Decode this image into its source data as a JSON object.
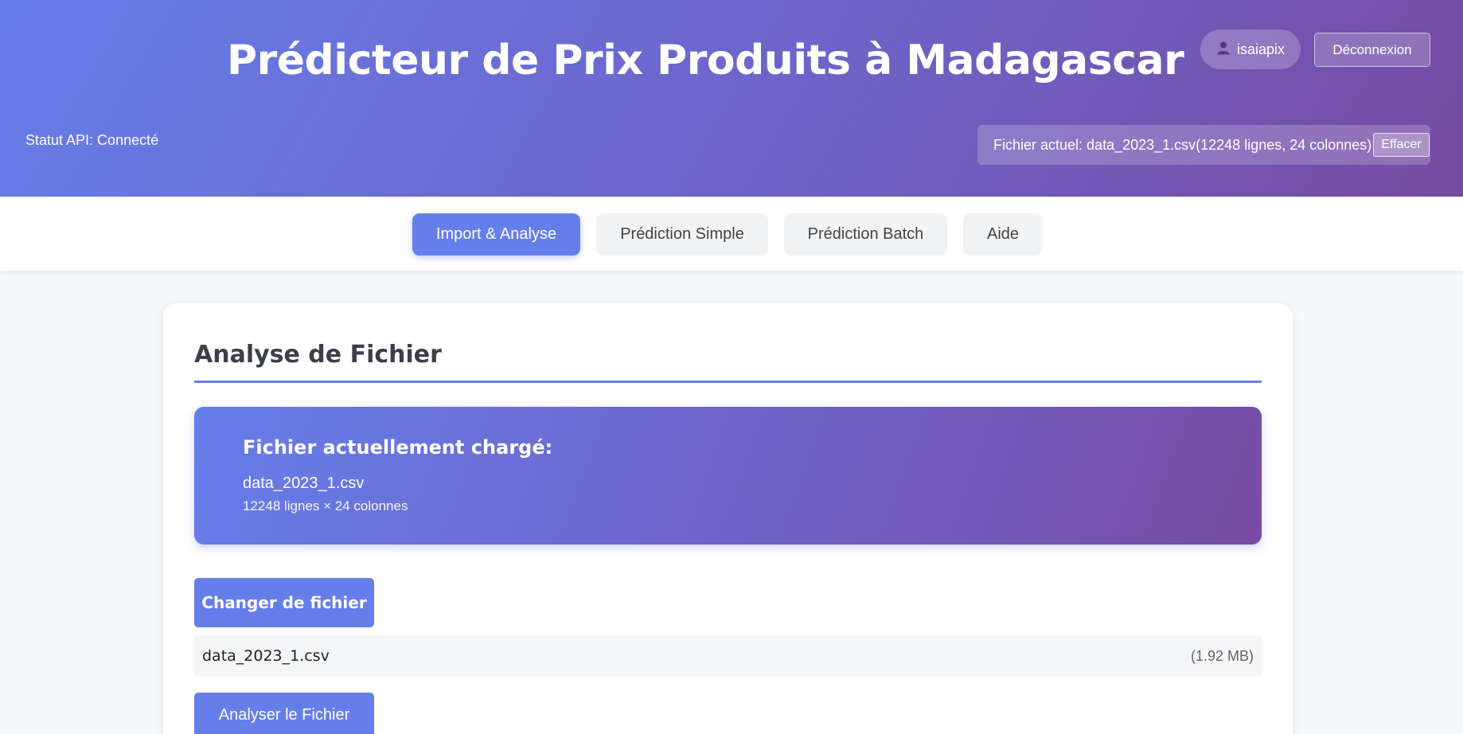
{
  "header": {
    "title": "Prédicteur de Prix Produits à Madagascar",
    "api_status": "Statut API: Connecté",
    "username": "isaiapix",
    "logout_label": "Déconnexion",
    "current_file_text": "Fichier actuel: data_2023_1.csv(12248 lignes, 24 colonnes)",
    "clear_label": "Effacer"
  },
  "tabs": [
    {
      "label": "Import & Analyse",
      "active": true
    },
    {
      "label": "Prédiction Simple",
      "active": false
    },
    {
      "label": "Prédiction Batch",
      "active": false
    },
    {
      "label": "Aide",
      "active": false
    }
  ],
  "main": {
    "section_title": "Analyse de Fichier",
    "loaded_title": "Fichier actuellement chargé:",
    "loaded_filename": "data_2023_1.csv",
    "loaded_dims": "12248 lignes × 24 colonnes",
    "change_file_label": "Changer de fichier",
    "selected_file": {
      "name": "data_2023_1.csv",
      "size": "(1.92 MB)"
    },
    "analyze_label": "Analyser le Fichier"
  },
  "colors": {
    "accent": "#667eea",
    "gradient_end": "#764ba2"
  },
  "icons": {
    "user": "user-icon"
  }
}
